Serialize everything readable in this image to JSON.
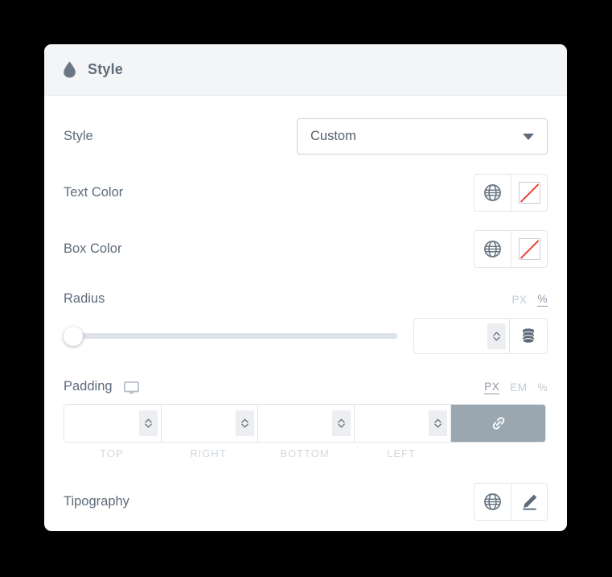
{
  "panel": {
    "title": "Style",
    "icon": "water-drop-icon"
  },
  "rows": {
    "style": {
      "label": "Style",
      "select": {
        "value": "Custom",
        "arrow_icon": "chevron-down-icon"
      }
    },
    "text_color": {
      "label": "Text Color",
      "globe_icon": "globe-icon",
      "swatch": "no-color-swatch"
    },
    "box_color": {
      "label": "Box Color",
      "globe_icon": "globe-icon",
      "swatch": "no-color-swatch"
    },
    "radius": {
      "label": "Radius",
      "units": [
        {
          "label": "PX",
          "active": false
        },
        {
          "label": "%",
          "active": true
        }
      ],
      "slider_value": 0,
      "input_value": "",
      "stepper_icon": "stepper-updown-icon",
      "database_icon": "database-icon"
    },
    "padding": {
      "label": "Padding",
      "device_icon": "desktop-monitor-icon",
      "units": [
        {
          "label": "PX",
          "active": true
        },
        {
          "label": "EM",
          "active": false
        },
        {
          "label": "%",
          "active": false
        }
      ],
      "fields": [
        {
          "label": "TOP",
          "value": ""
        },
        {
          "label": "RIGHT",
          "value": ""
        },
        {
          "label": "BOTTOM",
          "value": ""
        },
        {
          "label": "LEFT",
          "value": ""
        }
      ],
      "link_icon": "link-chain-icon",
      "link_active": true
    },
    "tipography": {
      "label": "Tipography",
      "globe_icon": "globe-icon",
      "edit_icon": "pencil-edit-icon"
    }
  },
  "colors": {
    "background": "#000000",
    "panel": "#ffffff",
    "header": "#f4f5f6",
    "label_text": "#5d6b7a",
    "border": "#e1e5e9",
    "slider_track": "#dee3e8",
    "link_active_bg": "#9aa7b1",
    "swatch_line": "#e8433a",
    "unit_inactive": "#c3cbd3",
    "unit_active": "#8d99a5"
  }
}
